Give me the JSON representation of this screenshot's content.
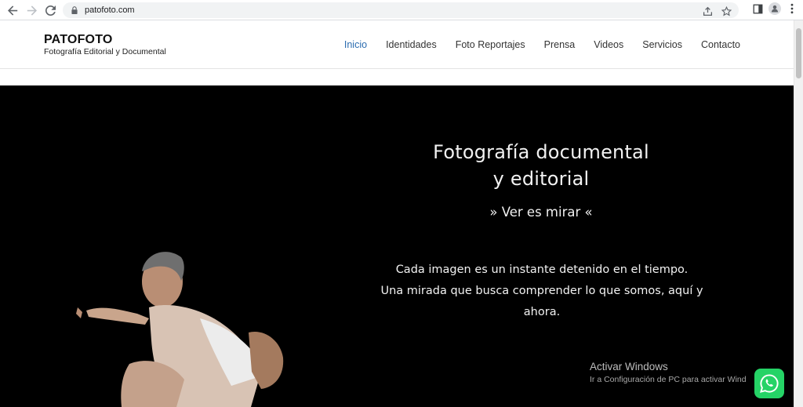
{
  "browser": {
    "url": "patofoto.com"
  },
  "header": {
    "brand_title": "PATOFOTO",
    "brand_subtitle": "Fotografía Editorial y Documental",
    "menu": [
      "Inicio",
      "Identidades",
      "Foto Reportajes",
      "Prensa",
      "Videos",
      "Servicios",
      "Contacto"
    ],
    "active_item": "Inicio"
  },
  "hero": {
    "title_line1": "Fotografía documental",
    "title_line2": "y editorial",
    "tagline": "» Ver es mirar «",
    "text_line1": "Cada imagen es un instante detenido en el tiempo.",
    "text_line2": "Una mirada que busca comprender lo que somos, aquí y ahora."
  },
  "overlay": {
    "watermark_title": "Activar Windows",
    "watermark_sub": "Ir a Configuración de PC para activar Wind"
  },
  "colors": {
    "accent": "#2b6cb0",
    "hero_bg": "#000000",
    "whatsapp": "#25d366"
  },
  "icons": [
    "back-icon",
    "forward-icon",
    "reload-icon",
    "lock-icon",
    "share-icon",
    "star-icon",
    "sidepanel-icon",
    "profile-icon",
    "kebab-menu-icon",
    "whatsapp-icon"
  ]
}
